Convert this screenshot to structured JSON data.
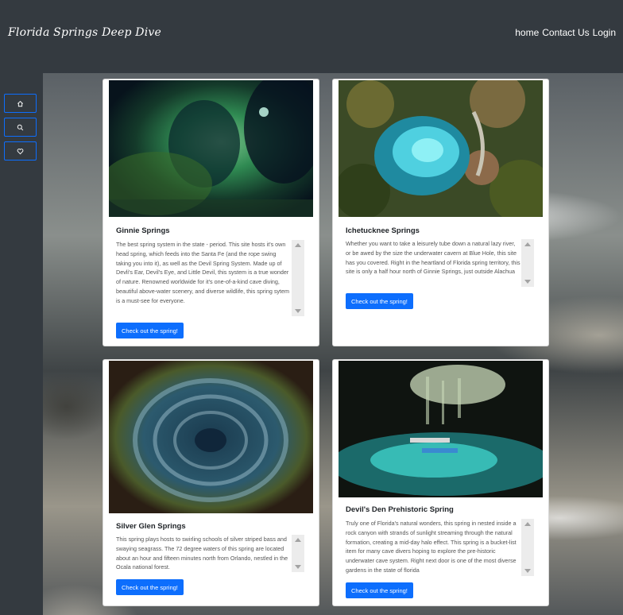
{
  "navbar": {
    "brand": "Florida Springs Deep Dive",
    "links": [
      "home",
      "Contact Us",
      "Login"
    ]
  },
  "sidebar": {
    "icons": [
      "home-icon",
      "search-icon",
      "heart-icon"
    ]
  },
  "colors": {
    "accent": "#0d6efd",
    "navbar_bg": "#343a40"
  },
  "cards": [
    {
      "title": "Ginnie Springs",
      "text": "The best spring system in the state - period. This site hosts it's own head spring, which feeds into the Santa Fe (and the rope swing taking you into it), as well as the Devil Spring System. Made up of Devli's Ear, Devil's Eye, and Little Devil, this system is a true wonder of nature. Renowned worldwide for it's one-of-a-kind cave diving, beautiful above-water scenery, and diverse wildlife, this spring sytem is a must-see for everyone.",
      "button": "Check out the spring!"
    },
    {
      "title": "Ichetucknee Springs",
      "text": "Whether you want to take a leisurely tube down a natural lazy river, or be awed by the size the underwater cavern at Blue Hole, this site has you covered. Right in the heartland of Florida spring territory, this site is only a half hour north of Ginnie Springs, just outside Alachua",
      "button": "Check out the spring!"
    },
    {
      "title": "Silver Glen Springs",
      "text": "This spring plays hosts to swirling schools of silver striped bass and swaying seagrass. The 72 degree waters of this spring are located about an hour and fifteen minutes north from Orlando, nestled in the Ocala national forest.",
      "button": "Check out the spring!"
    },
    {
      "title": "Devil's Den Prehistoric Spring",
      "text": "Truly one of Florida's natural wonders, this spring in nested inside a rock canyon with strands of sunlight streaming through the natural formation, creating a mid-day halo effect. This spring is a bucket-list item for many cave divers hoping to explore the pre-historic underwater cave system. Right next door is one of the most diverse gardens in the state of florida",
      "button": "Check out the spring!"
    }
  ]
}
